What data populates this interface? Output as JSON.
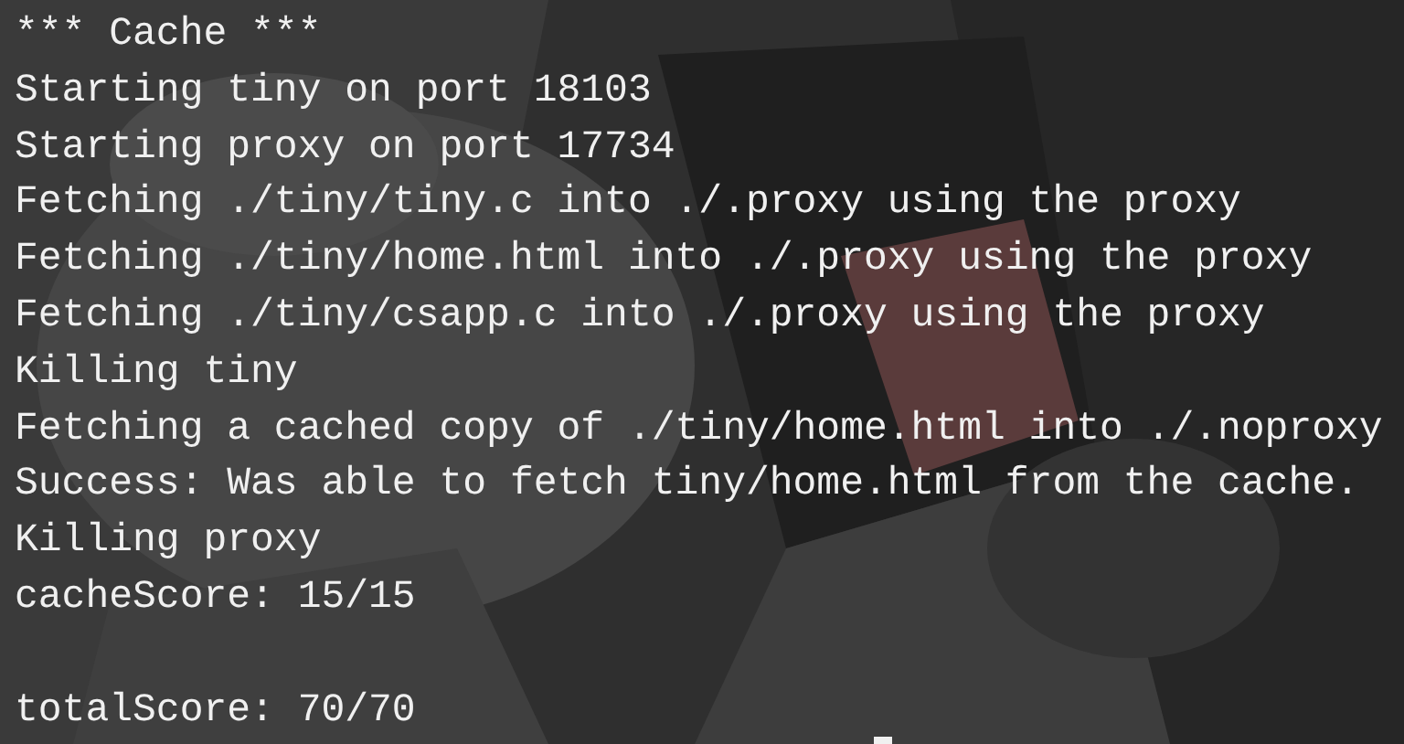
{
  "terminal": {
    "lines": [
      "*** Cache ***",
      "Starting tiny on port 18103",
      "Starting proxy on port 17734",
      "Fetching ./tiny/tiny.c into ./.proxy using the proxy",
      "Fetching ./tiny/home.html into ./.proxy using the proxy",
      "Fetching ./tiny/csapp.c into ./.proxy using the proxy",
      "Killing tiny",
      "Fetching a cached copy of ./tiny/home.html into ./.noproxy",
      "Success: Was able to fetch tiny/home.html from the cache.",
      "Killing proxy",
      "cacheScore: 15/15"
    ],
    "footer_lines": [
      "totalScore: 70/70"
    ]
  }
}
